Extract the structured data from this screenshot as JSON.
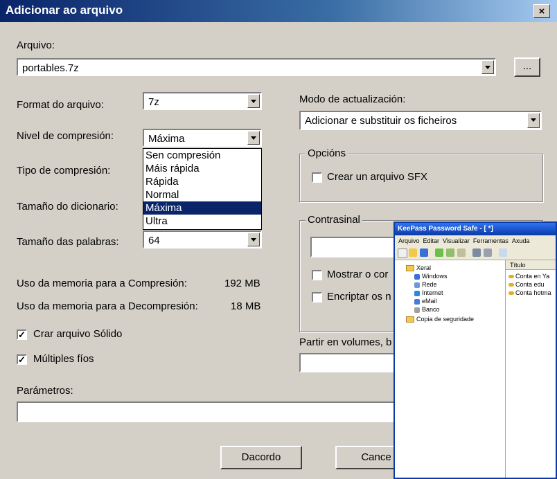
{
  "dialog": {
    "title": "Adicionar ao arquivo",
    "close_label": "×",
    "archive_label": "Arquivo:",
    "archive_value": "portables.7z",
    "browse_label": "...",
    "format_label": "Format do arquivo:",
    "format_value": "7z",
    "level_label": "Nivel de compresión:",
    "level_value": "Máxima",
    "level_options": [
      "Sen compresión",
      "Máis rápida",
      "Rápida",
      "Normal",
      "Máxima",
      "Ultra"
    ],
    "level_selected_index": 4,
    "method_label": "Tipo de compresión:",
    "dict_label": "Tamaño do dicionario:",
    "word_label": "Tamaño das palabras:",
    "word_value": "64",
    "mem_comp_label": "Uso da memoria para a Compresión:",
    "mem_comp_value": "192 MB",
    "mem_decomp_label": "Uso da memoria para a Decompresión:",
    "mem_decomp_value": "18 MB",
    "solid_label": "Crar arquivo Sólido",
    "solid_checked": true,
    "multi_label": "Múltiples fíos",
    "multi_checked": true,
    "params_label": "Parámetros:",
    "params_value": "",
    "update_label": "Modo de actualización:",
    "update_value": "Adicionar e substituir os ficheiros",
    "options_legend": "Opcións",
    "sfx_label": "Crear un arquivo SFX",
    "password_legend": "Contrasinal",
    "show_pw_label": "Mostrar o cor",
    "encrypt_label": "Encriptar os n",
    "split_label": "Partir en volumes, b",
    "ok_label": "Dacordo",
    "cancel_label": "Cance",
    "check_mark": "✓"
  },
  "keepass": {
    "title": "KeePass Password Safe - [ *]",
    "menu": [
      "Arquivo",
      "Editar",
      "Visualizar",
      "Ferramentas",
      "Axuda"
    ],
    "tree": [
      {
        "label": "Xeral",
        "icon": "folder-open-icon"
      },
      {
        "label": "Windows",
        "icon": "window-icon"
      },
      {
        "label": "Rede",
        "icon": "network-icon"
      },
      {
        "label": "Internet",
        "icon": "globe-icon"
      },
      {
        "label": "eMail",
        "icon": "mail-icon"
      },
      {
        "label": "Banco",
        "icon": "bank-icon"
      },
      {
        "label": "Copia de seguridade",
        "icon": "backup-folder-icon"
      }
    ],
    "list_header": "Título",
    "entries": [
      "Conta en Ya",
      "Conta edu",
      "Conta hotma"
    ]
  }
}
